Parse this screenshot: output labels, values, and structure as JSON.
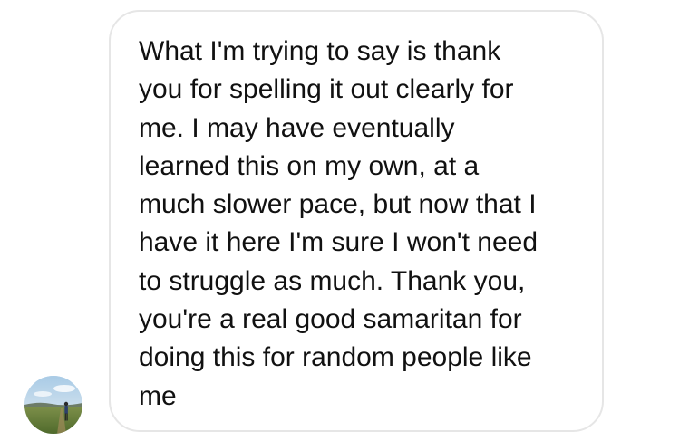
{
  "conversation": {
    "message": {
      "lines": [
        "What I'm trying to say is thank",
        "you for spelling it out clearly for",
        "me. I may have eventually",
        "learned this on my own, at a",
        "much slower pace, but now that I",
        "have it here I'm sure I won't need",
        "to struggle as much. Thank you,",
        "you're a real good samaritan for",
        "doing this for random people like",
        "me"
      ]
    },
    "sender": {
      "avatar_icon": "profile-photo-person-in-field"
    },
    "colors": {
      "bubble_border": "#e6e6e6",
      "text": "#111111",
      "background": "#ffffff"
    }
  }
}
